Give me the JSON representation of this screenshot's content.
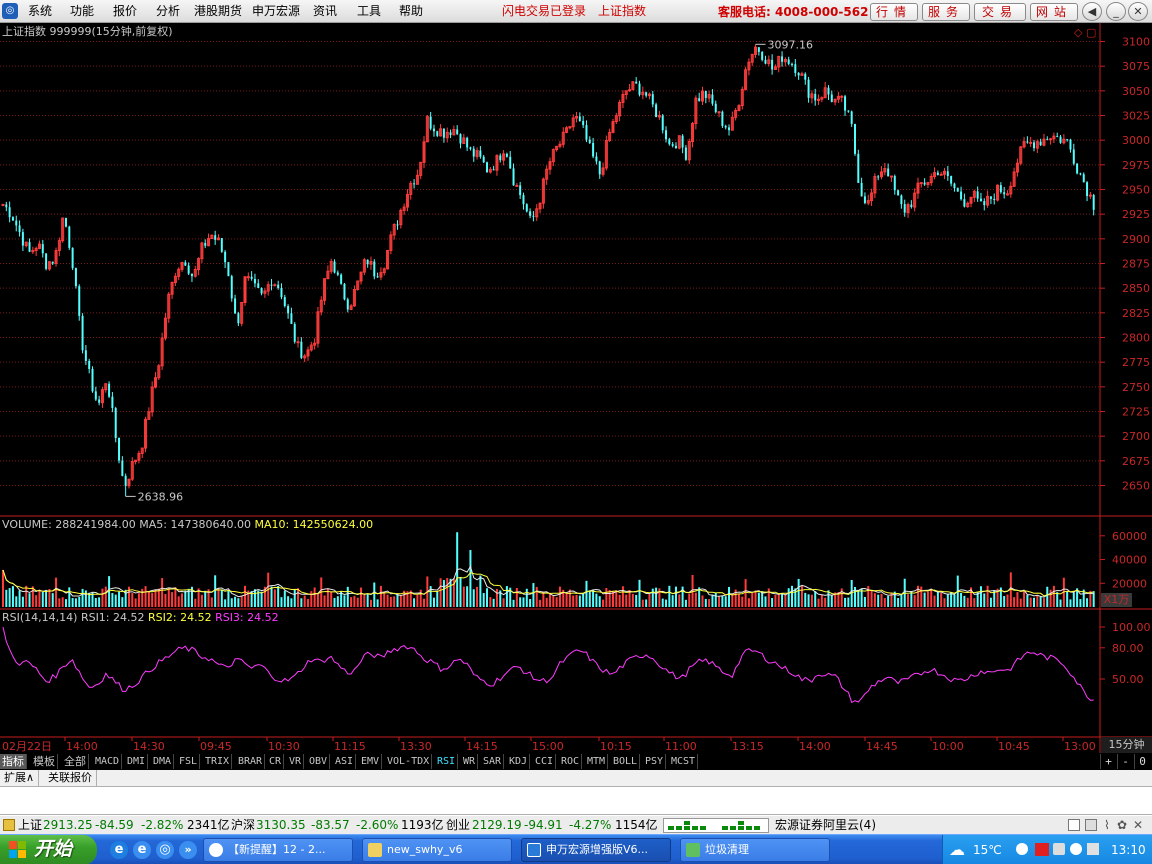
{
  "menu": {
    "items": [
      "系统",
      "功能",
      "报价",
      "分析",
      "港股期货",
      "申万宏源",
      "资讯",
      "工具",
      "帮助"
    ],
    "promo1": "闪电交易已登录",
    "promo2": "上证指数",
    "hotline": "客服电话: 4008-000-562",
    "buttons": [
      "行情",
      "服务",
      "交易",
      "网站"
    ]
  },
  "main_chart": {
    "title": "上证指数 999999(15分钟,前复权)",
    "high_label": "3097.16",
    "low_label": "2638.96",
    "price_ticks": [
      "3100",
      "3075",
      "3050",
      "3025",
      "3000",
      "2975",
      "2950",
      "2925",
      "2900",
      "2875",
      "2850",
      "2825",
      "2800",
      "2775",
      "2750",
      "2725",
      "2700",
      "2675",
      "2650"
    ],
    "colors": {
      "up": "#ff3c3c",
      "down": "#54ffff",
      "grid": "#7a1a1a",
      "axis": "#c81e1e",
      "tick_text": "#c82828"
    }
  },
  "volume": {
    "label": "VOLUME: 288241984.00",
    "ma5": "MA5: 147380640.00",
    "ma10": "MA10: 142550624.00",
    "ticks": [
      "60000",
      "40000",
      "20000"
    ],
    "unit": "X1万"
  },
  "rsi": {
    "label": "RSI(14,14,14)",
    "rsi1": "RSI1: 24.52",
    "rsi2": "RSI2: 24.52",
    "rsi3": "RSI3: 24.52",
    "ticks": [
      "100.00",
      "80.00",
      "50.00"
    ]
  },
  "time_axis": {
    "labels": [
      "02月22日",
      "14:00",
      "14:30",
      "09:45",
      "10:30",
      "11:15",
      "13:30",
      "14:15",
      "15:00",
      "10:15",
      "11:00",
      "13:15",
      "14:00",
      "14:45",
      "10:00",
      "10:45",
      "13:00"
    ],
    "period": "15分钟"
  },
  "tabs": [
    "指标",
    "模板",
    "全部",
    "MACD",
    "DMI",
    "DMA",
    "FSL",
    "TRIX",
    "BRAR",
    "CR",
    "VR",
    "OBV",
    "ASI",
    "EMV",
    "VOL-TDX",
    "RSI",
    "WR",
    "SAR",
    "KDJ",
    "CCI",
    "ROC",
    "MTM",
    "BOLL",
    "PSY",
    "MCST"
  ],
  "tab_controls": [
    "+",
    "-",
    "0"
  ],
  "expand": {
    "a": "扩展∧",
    "b": "关联报价"
  },
  "status": {
    "sh_name": "上证",
    "sh_val": "2913.25",
    "sh_chg": "-84.59",
    "sh_pct": "-2.82%",
    "sh_amt": "2341亿",
    "hs_name": "沪深",
    "hs_val": "3130.35",
    "hs_chg": "-83.57",
    "hs_pct": "-2.60%",
    "hs_amt": "1193亿",
    "cy_name": "创业",
    "cy_val": "2129.19",
    "cy_chg": "-94.91",
    "cy_pct": "-4.27%",
    "cy_amt": "1154亿",
    "server": "宏源证券阿里云(4)"
  },
  "taskbar": {
    "start": "开始",
    "tasks": [
      "【新提醒】12 - 2...",
      "new_swhy_v6",
      "申万宏源增强版V6...",
      "垃圾清理"
    ],
    "temp": "15℃",
    "clock": "13:10"
  },
  "chart_data": {
    "type": "candlestick",
    "title": "上证指数 999999(15分钟,前复权)",
    "period": "15分钟",
    "ylim": [
      2630,
      3110
    ],
    "y_ticks": [
      3100,
      3075,
      3050,
      3025,
      3000,
      2975,
      2950,
      2925,
      2900,
      2875,
      2850,
      2825,
      2800,
      2775,
      2750,
      2725,
      2700,
      2675,
      2650
    ],
    "high_annotation": {
      "label": "3097.16",
      "value": 3097.16
    },
    "low_annotation": {
      "label": "2638.96",
      "value": 2638.96
    },
    "x_labels": [
      "02月22日",
      "14:00",
      "14:30",
      "09:45",
      "10:30",
      "11:15",
      "13:30",
      "14:15",
      "15:00",
      "10:15",
      "11:00",
      "13:15",
      "14:00",
      "14:45",
      "10:00",
      "10:45",
      "13:00"
    ],
    "close_path": [
      2935,
      2925,
      2905,
      2885,
      2895,
      2875,
      2880,
      2925,
      2880,
      2800,
      2760,
      2730,
      2760,
      2700,
      2648,
      2672,
      2690,
      2735,
      2775,
      2835,
      2870,
      2880,
      2860,
      2890,
      2905,
      2895,
      2868,
      2810,
      2860,
      2850,
      2840,
      2860,
      2850,
      2820,
      2790,
      2782,
      2800,
      2850,
      2880,
      2850,
      2832,
      2855,
      2880,
      2865,
      2875,
      2905,
      2930,
      2955,
      2968,
      3020,
      3012,
      3008,
      3012,
      3002,
      2988,
      2982,
      2970,
      2978,
      2995,
      2960,
      2940,
      2915,
      2940,
      2975,
      2992,
      3005,
      3025,
      3010,
      2985,
      2965,
      3005,
      3030,
      3050,
      3055,
      3050,
      3035,
      3020,
      2995,
      3000,
      2985,
      3040,
      3048,
      3035,
      3020,
      3010,
      3040,
      3080,
      3095,
      3085,
      3070,
      3085,
      3080,
      3070,
      3050,
      3042,
      3050,
      3040,
      3038,
      3015,
      2950,
      2935,
      2965,
      2975,
      2948,
      2928,
      2938,
      2955,
      2960,
      2970,
      2962,
      2950,
      2938,
      2945,
      2932,
      2940,
      2950,
      2948,
      2975,
      2995,
      2998,
      3000,
      3005,
      3002,
      2998,
      2975,
      2955,
      2935
    ],
    "volume_ticks": [
      60000,
      40000,
      20000
    ],
    "volume_unit": "X1万",
    "rsi_ticks": [
      100,
      80,
      50
    ],
    "rsi_path": [
      98,
      72,
      65,
      66,
      58,
      48,
      52,
      62,
      70,
      55,
      42,
      45,
      55,
      48,
      40,
      43,
      50,
      58,
      65,
      70,
      76,
      80,
      78,
      72,
      70,
      64,
      60,
      68,
      66,
      60,
      64,
      55,
      50,
      48,
      52,
      62,
      70,
      66,
      72,
      64,
      56,
      58,
      72,
      74,
      70,
      77,
      80,
      82,
      78,
      70,
      66,
      60,
      62,
      70,
      64,
      52,
      48,
      45,
      52,
      58,
      62,
      56,
      50,
      48,
      52,
      66,
      72,
      78,
      73,
      64,
      58,
      54,
      62,
      68,
      72,
      74,
      68,
      60,
      54,
      50,
      60,
      66,
      68,
      62,
      56,
      54,
      72,
      78,
      75,
      69,
      65,
      60,
      56,
      50,
      48,
      56,
      54,
      52,
      40,
      28,
      30,
      42,
      48,
      52,
      46,
      48,
      52,
      56,
      60,
      56,
      52,
      48,
      50,
      54,
      58,
      56,
      60,
      58,
      66,
      74,
      76,
      72,
      70,
      68,
      60,
      48,
      36,
      30
    ]
  }
}
